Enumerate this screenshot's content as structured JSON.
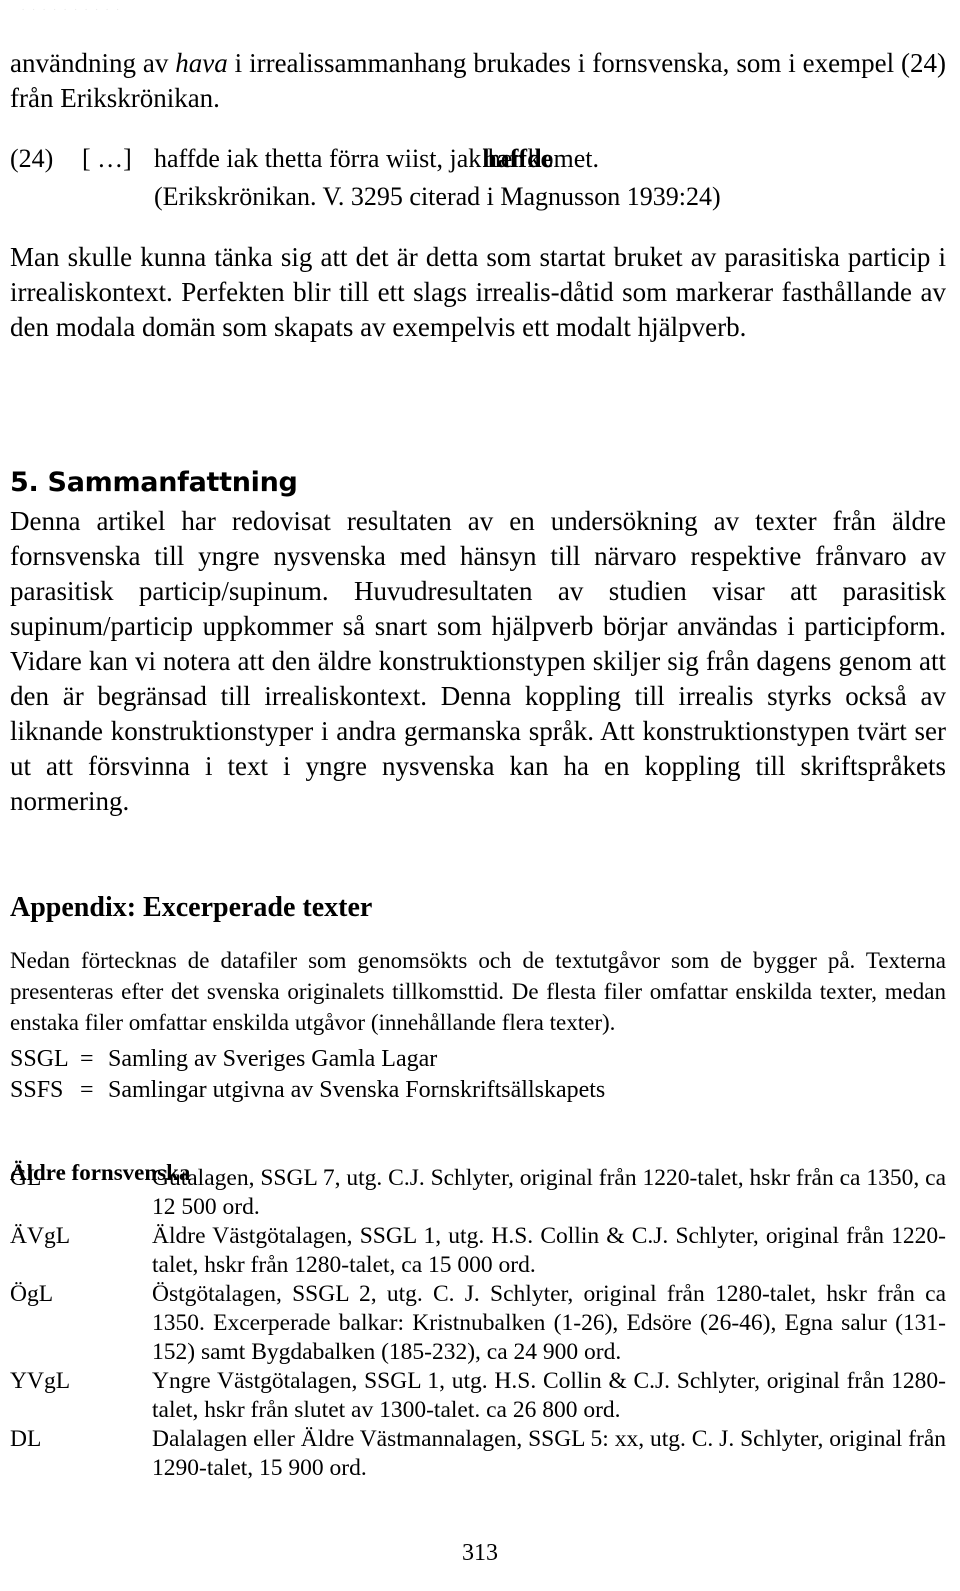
{
  "document": {
    "running_header": ". .   .    .    .  .     . .   . .",
    "page_number": "313"
  },
  "content": {
    "first_paragraph": {
      "before_italic": "användning av ",
      "italic_word": "hava",
      "after_italic": " i irrealissammanhang brukades i fornsvenska, som i exempel (24) från Erikskrönikan."
    },
    "example": {
      "number": "(24)",
      "brackets": "[ …]",
      "text_before_overlap": "haffde iak thetta förra wiist, ja",
      "overlap_under": "k",
      "overlap_over": "haffde",
      "text_after_overlap": " her komet.",
      "source": "(Erikskrönikan. V. 3295 citerad i Magnusson 1939:24)"
    },
    "second_paragraph": "Man skulle kunna tänka sig att det är detta som startat bruket av parasitiska particip i irrealiskontext. Perfekten blir till ett slags irrealis-dåtid som markerar fasthållande av den modala domän som skapats av exempelvis ett modalt hjälpverb.",
    "section_heading": "5. Sammanfattning",
    "summary_paragraph": "Denna artikel har redovisat resultaten av en undersökning av texter från äldre fornsvenska till yngre nysvenska med hänsyn till närvaro respektive frånvaro av parasitisk particip/supinum. Huvudresultaten av studien visar att parasitisk supinum/particip uppkommer så snart som hjälpverb börjar användas i participform. Vidare kan vi notera att den äldre konstruktionstypen skiljer sig från dagens genom att den är begränsad till irrealiskontext. Denna koppling till irrealis styrks också av liknande konstruktionstyper i andra germanska språk. Att konstruktionstypen tvärt ser ut att försvinna i text i yngre nysvenska kan ha en koppling till skriftspråkets normering.",
    "appendix_heading": "Appendix: Excerperade texter",
    "appendix_intro": "Nedan förtecknas de datafiler som genomsökts och de textutgåvor som de bygger på. Texterna presenteras efter det svenska originalets tillkomsttid. De flesta filer omfattar enskilda texter, medan enstaka filer omfattar enskilda utgåvor (innehållande flera texter).",
    "abbreviations": [
      {
        "key": "SSGL",
        "eq": "=",
        "expansion": "Samling av Sveriges Gamla Lagar"
      },
      {
        "key": "SSFS",
        "eq": "=",
        "expansion": "Samlingar utgivna av Svenska Fornskriftsällskapets"
      }
    ],
    "subsection_heading": "Äldre fornsvenska",
    "entries": [
      {
        "abbr": "GL",
        "description": "Gutalagen, SSGL 7, utg. C.J. Schlyter, original från 1220-talet, hskr från ca 1350, ca 12 500 ord."
      },
      {
        "abbr": "ÄVgL",
        "description": "Äldre Västgötalagen, SSGL 1, utg. H.S. Collin & C.J. Schlyter, original från 1220-talet, hskr från 1280-talet, ca 15 000 ord."
      },
      {
        "abbr": "ÖgL",
        "description": "Östgötalagen, SSGL 2, utg. C. J. Schlyter, original från 1280-talet, hskr från ca 1350. Excerperade balkar: Kristnubalken (1-26), Edsöre (26-46), Egna salur (131-152) samt Bygdabalken (185-232), ca 24 900 ord."
      },
      {
        "abbr": "YVgL",
        "description": "Yngre Västgötalagen, SSGL 1, utg. H.S. Collin & C.J. Schlyter, original från 1280-talet, hskr från slutet av 1300-talet. ca 26 800 ord."
      },
      {
        "abbr": "DL",
        "description": "Dalalagen eller Äldre Västmannalagen, SSGL 5: xx, utg. C. J. Schlyter, original från 1290-talet, 15 900 ord."
      }
    ]
  }
}
